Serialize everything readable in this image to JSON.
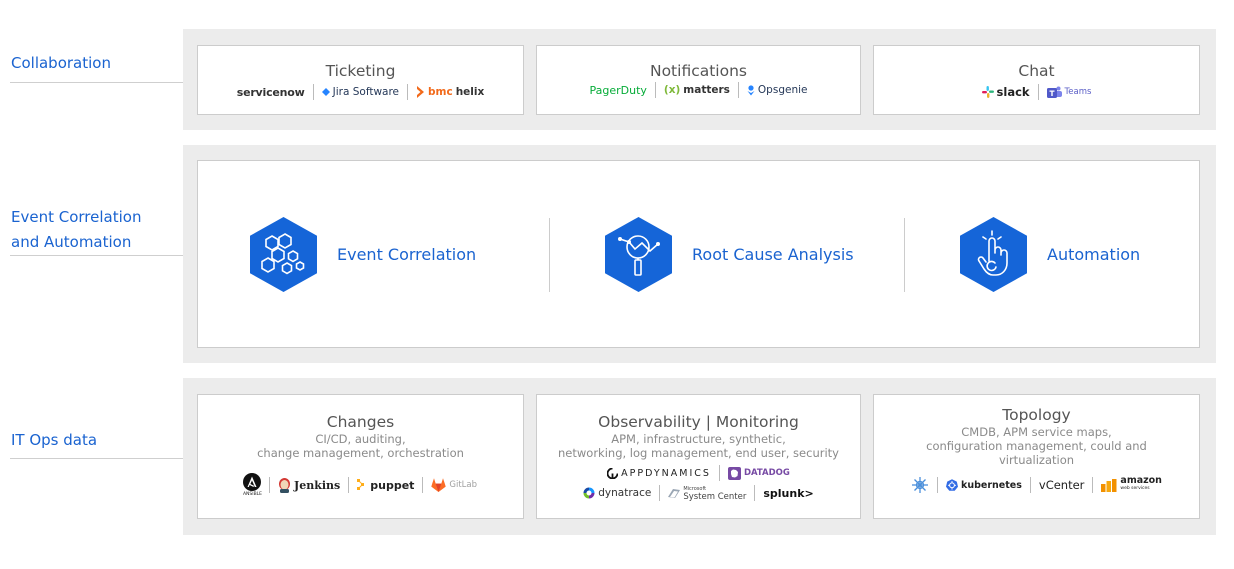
{
  "sections": {
    "collaboration": "Collaboration",
    "correlation_line1": "Event Correlation",
    "correlation_line2": "and Automation",
    "itops": "IT Ops data"
  },
  "collaboration": {
    "ticketing": {
      "title": "Ticketing",
      "logos": [
        "servicenow",
        "Jira Software",
        "bmc",
        "helix"
      ]
    },
    "notifications": {
      "title": "Notifications",
      "logos": [
        "PagerDuty",
        "(x)",
        "matters",
        "Opsgenie"
      ]
    },
    "chat": {
      "title": "Chat",
      "logos": [
        "slack",
        "Teams"
      ]
    }
  },
  "correlation": {
    "event_correlation": "Event Correlation",
    "root_cause": "Root Cause Analysis",
    "automation": "Automation"
  },
  "itops": {
    "changes": {
      "title": "Changes",
      "sub1": "CI/CD, auditing,",
      "sub2": "change management, orchestration",
      "logos": [
        "ANSIBLE",
        "Jenkins",
        "puppet",
        "GitLab"
      ]
    },
    "observability": {
      "title": "Observability | Monitoring",
      "sub1": "APM, infrastructure, synthetic,",
      "sub2": "networking, log management, end user, security",
      "logos_row1": [
        "APPDYNAMICS",
        "DATADOG"
      ],
      "logos_row2": [
        "dynatrace",
        "Microsoft",
        "System Center",
        "splunk>"
      ]
    },
    "topology": {
      "title": "Topology",
      "sub1": "CMDB, APM service maps,",
      "sub2": "configuration management, could and",
      "sub3": "virtualization",
      "logos": [
        "kubernetes",
        "vCenter",
        "amazon",
        "web services"
      ]
    }
  },
  "colors": {
    "brand_blue": "#1a63d0",
    "hex_blue": "#1565d8",
    "band_gray": "#ececec",
    "card_border": "#cccccc"
  }
}
